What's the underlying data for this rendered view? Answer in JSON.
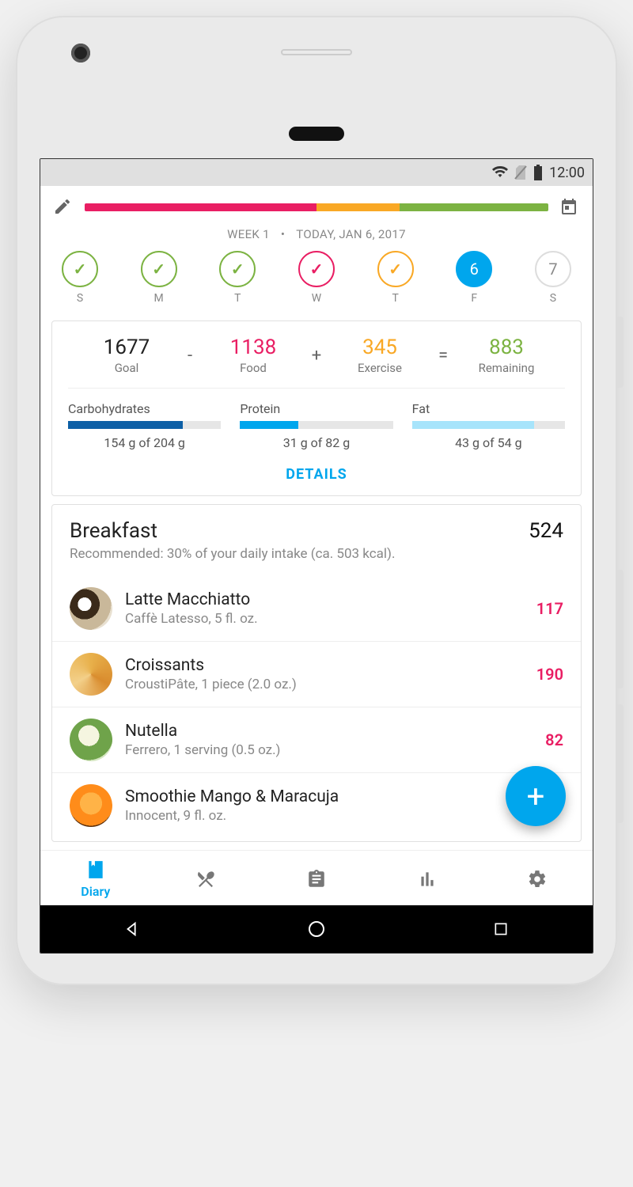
{
  "statusbar": {
    "time": "12:00"
  },
  "header": {
    "week_label": "WEEK 1",
    "dot": "•",
    "date_label": "TODAY, JAN 6, 2017",
    "days": [
      {
        "letter": "S",
        "style": "dc-green",
        "content": "check"
      },
      {
        "letter": "M",
        "style": "dc-green",
        "content": "check"
      },
      {
        "letter": "T",
        "style": "dc-green",
        "content": "check"
      },
      {
        "letter": "W",
        "style": "dc-pink",
        "content": "check"
      },
      {
        "letter": "T",
        "style": "dc-yellow",
        "content": "check"
      },
      {
        "letter": "F",
        "style": "dc-blue",
        "content": "6"
      },
      {
        "letter": "S",
        "style": "dc-grey",
        "content": "7"
      }
    ]
  },
  "summary": {
    "goal": {
      "value": "1677",
      "label": "Goal"
    },
    "food": {
      "value": "1138",
      "label": "Food"
    },
    "exercise": {
      "value": "345",
      "label": "Exercise"
    },
    "remaining": {
      "value": "883",
      "label": "Remaining"
    },
    "op_minus": "-",
    "op_plus": "+",
    "op_eq": "=",
    "macros": {
      "carb": {
        "label": "Carbohydrates",
        "text": "154 g of 204 g"
      },
      "prot": {
        "label": "Protein",
        "text": "31 g of 82 g"
      },
      "fat": {
        "label": "Fat",
        "text": "43 g of 54 g"
      }
    },
    "details_label": "DETAILS"
  },
  "meal": {
    "title": "Breakfast",
    "total": "524",
    "subtitle": "Recommended: 30% of your daily intake (ca. 503 kcal).",
    "items": [
      {
        "name": "Latte Macchiatto",
        "desc": "Caffè Latesso, 5 fl. oz.",
        "cal": "117",
        "img": "fi-latte"
      },
      {
        "name": "Croissants",
        "desc": "CroustiPâte, 1 piece (2.0 oz.)",
        "cal": "190",
        "img": "fi-croiss"
      },
      {
        "name": "Nutella",
        "desc": "Ferrero, 1 serving (0.5 oz.)",
        "cal": "82",
        "img": "fi-nutella"
      },
      {
        "name": "Smoothie Mango & Maracuja",
        "desc": "Innocent, 9 fl. oz.",
        "cal": "",
        "img": "fi-smooth"
      }
    ]
  },
  "nav": {
    "diary": "Diary"
  }
}
